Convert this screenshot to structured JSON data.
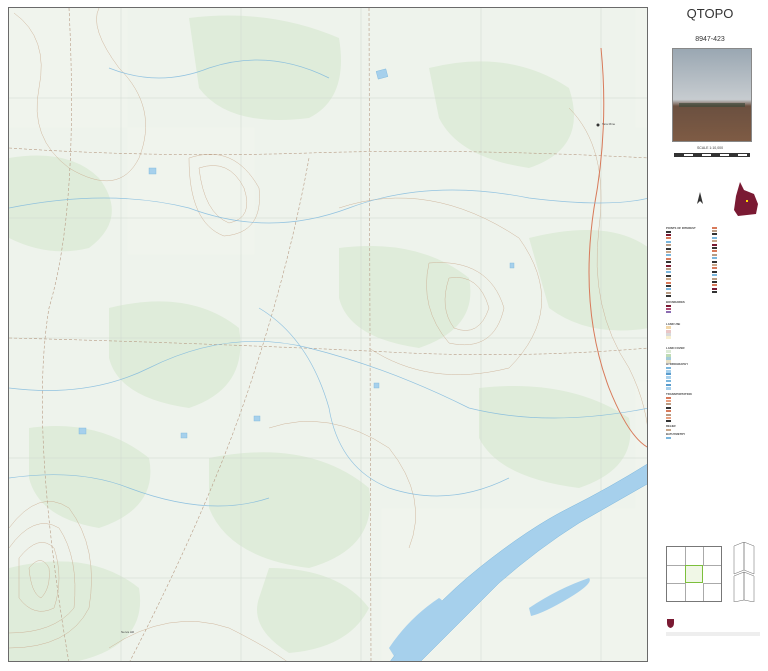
{
  "sheet": {
    "title": "QTOPO",
    "number": "8947-423",
    "scale_label": "SCALE 1:10,000",
    "place_label_1": "Tara Mine",
    "place_label_2": "Nerva Hill"
  },
  "legend": {
    "reliability_heading": "POINTS OF INTEREST",
    "boundaries_heading": "BOUNDARIES",
    "land_use_heading": "LAND USE",
    "land_cover_heading": "LAND COVER",
    "hydrography_heading": "HYDROGRAPHY",
    "transportation_heading": "TRANSPORTATION",
    "relief_heading": "RELIEF",
    "bathymetry_heading": "BATHYMETRY"
  },
  "colors": {
    "river": "#a6d0ec",
    "vegetation": "#dcebd6",
    "contour": "#c8a78a",
    "major_road": "#d87a5a",
    "track": "#b89c85",
    "grid": "#cfd8cf"
  },
  "icons": [
    "queensland-locator-map-icon",
    "north-arrow-icon",
    "queensland-crest-icon"
  ]
}
